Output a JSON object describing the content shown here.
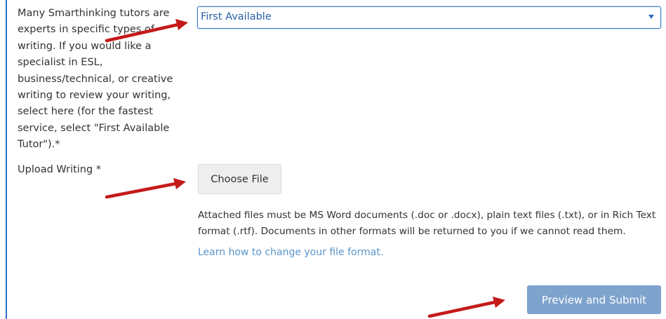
{
  "form": {
    "specialist_label": "Many Smarthinking tutors are experts in specific types of writing. If you would like a specialist in ESL, business/technical, or creative writing to review your writing, select here (for the fastest service, select \"First Available Tutor\").*",
    "tutor_select": {
      "selected_value": "First Available"
    },
    "upload_label": "Upload Writing *",
    "choose_file_label": "Choose File",
    "help_text": "Attached files must be MS Word documents (.doc or .docx), plain text files (.txt), or in Rich Text format (.rtf). Documents in other formats will be returned to you if we cannot read them.",
    "learn_link": "Learn how to change your file format.",
    "submit_label": "Preview and Submit"
  },
  "colors": {
    "accent_border": "#3d7ac9",
    "select_text": "#2a5fa8",
    "link": "#5b95c9",
    "submit_bg": "#7ea3cd",
    "arrow": "#c41a1a",
    "rule": "#2f6fbf"
  },
  "icons": {
    "select_caret": "chevron-down-icon",
    "annotation": "red-arrow-icon"
  }
}
